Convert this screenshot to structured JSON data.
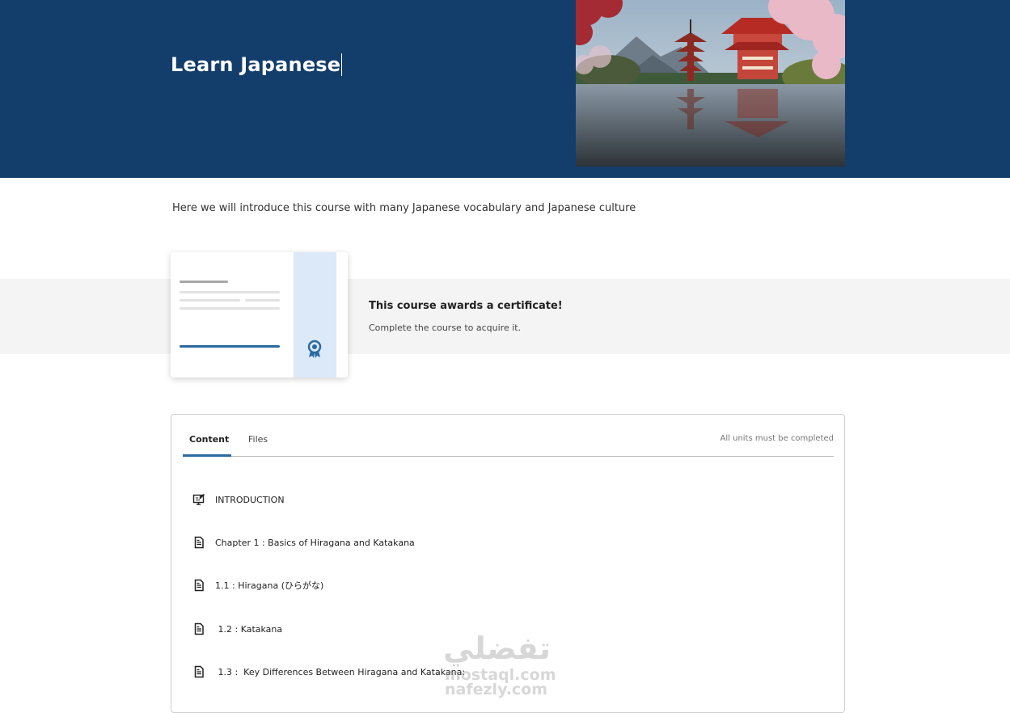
{
  "hero": {
    "title": "Learn Japanese",
    "background_color": "#133d6b",
    "image": "japanese-pagoda-lake-photo"
  },
  "intro": {
    "text": "Here we will introduce this course with many Japanese vocabulary and Japanese culture"
  },
  "certificate": {
    "title": "This course awards a certificate!",
    "subtitle": "Complete the course to acquire it.",
    "icon": "award-ribbon-icon"
  },
  "content_panel": {
    "tabs": [
      {
        "label": "Content",
        "active": true
      },
      {
        "label": "Files",
        "active": false
      }
    ],
    "requirement": "All units must be completed",
    "units": [
      {
        "label": "INTRODUCTION",
        "icon": "monitor-edit-icon"
      },
      {
        "label": "Chapter 1 : Basics of Hiragana and Katakana",
        "icon": "document-icon"
      },
      {
        "label": "1.1 : Hiragana (ひらがな)",
        "icon": "document-icon"
      },
      {
        "label": " 1.2 : Katakana",
        "icon": "document-icon"
      },
      {
        "label": " 1.3 :  Key Differences Between Hiragana and Katakana:",
        "icon": "document-icon"
      }
    ]
  },
  "watermark": {
    "line1": "تفضلي",
    "line2": "mostaql.com",
    "line3": "nafezly.com"
  },
  "colors": {
    "accent": "#2b6aa0",
    "band": "#f4f4f4",
    "cert_side": "#dce9f8"
  }
}
